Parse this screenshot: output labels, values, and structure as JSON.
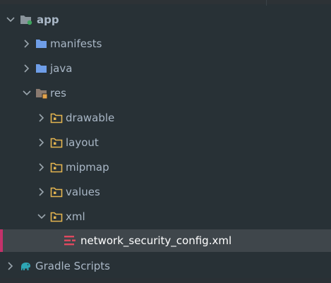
{
  "project_tree": {
    "app": {
      "label": "app",
      "icon": "android-module-folder-icon",
      "expanded": true
    },
    "manifests": {
      "label": "manifests",
      "icon": "blue-folder-icon",
      "expanded": false
    },
    "java": {
      "label": "java",
      "icon": "blue-folder-icon",
      "expanded": false
    },
    "res": {
      "label": "res",
      "icon": "resource-folder-icon",
      "expanded": true
    },
    "drawable": {
      "label": "drawable",
      "icon": "resource-package-folder-icon",
      "expanded": false
    },
    "layout": {
      "label": "layout",
      "icon": "resource-package-folder-icon",
      "expanded": false
    },
    "mipmap": {
      "label": "mipmap",
      "icon": "resource-package-folder-icon",
      "expanded": false
    },
    "values": {
      "label": "values",
      "icon": "resource-package-folder-icon",
      "expanded": false
    },
    "xml": {
      "label": "xml",
      "icon": "resource-package-folder-icon",
      "expanded": true
    },
    "network_security_config": {
      "label": "network_security_config.xml",
      "icon": "xml-file-icon",
      "selected": true
    },
    "gradle_scripts": {
      "label": "Gradle Scripts",
      "icon": "gradle-elephant-icon",
      "expanded": false
    }
  },
  "colors": {
    "background": "#283136",
    "selection": "#3f464b",
    "selection_marker": "#c4326a",
    "text": "#a9b7c6",
    "folder_blue": "#6f9ee8",
    "folder_orange": "#e3b450",
    "xml_red": "#e0495f",
    "gradle_teal": "#2ea6b5"
  }
}
